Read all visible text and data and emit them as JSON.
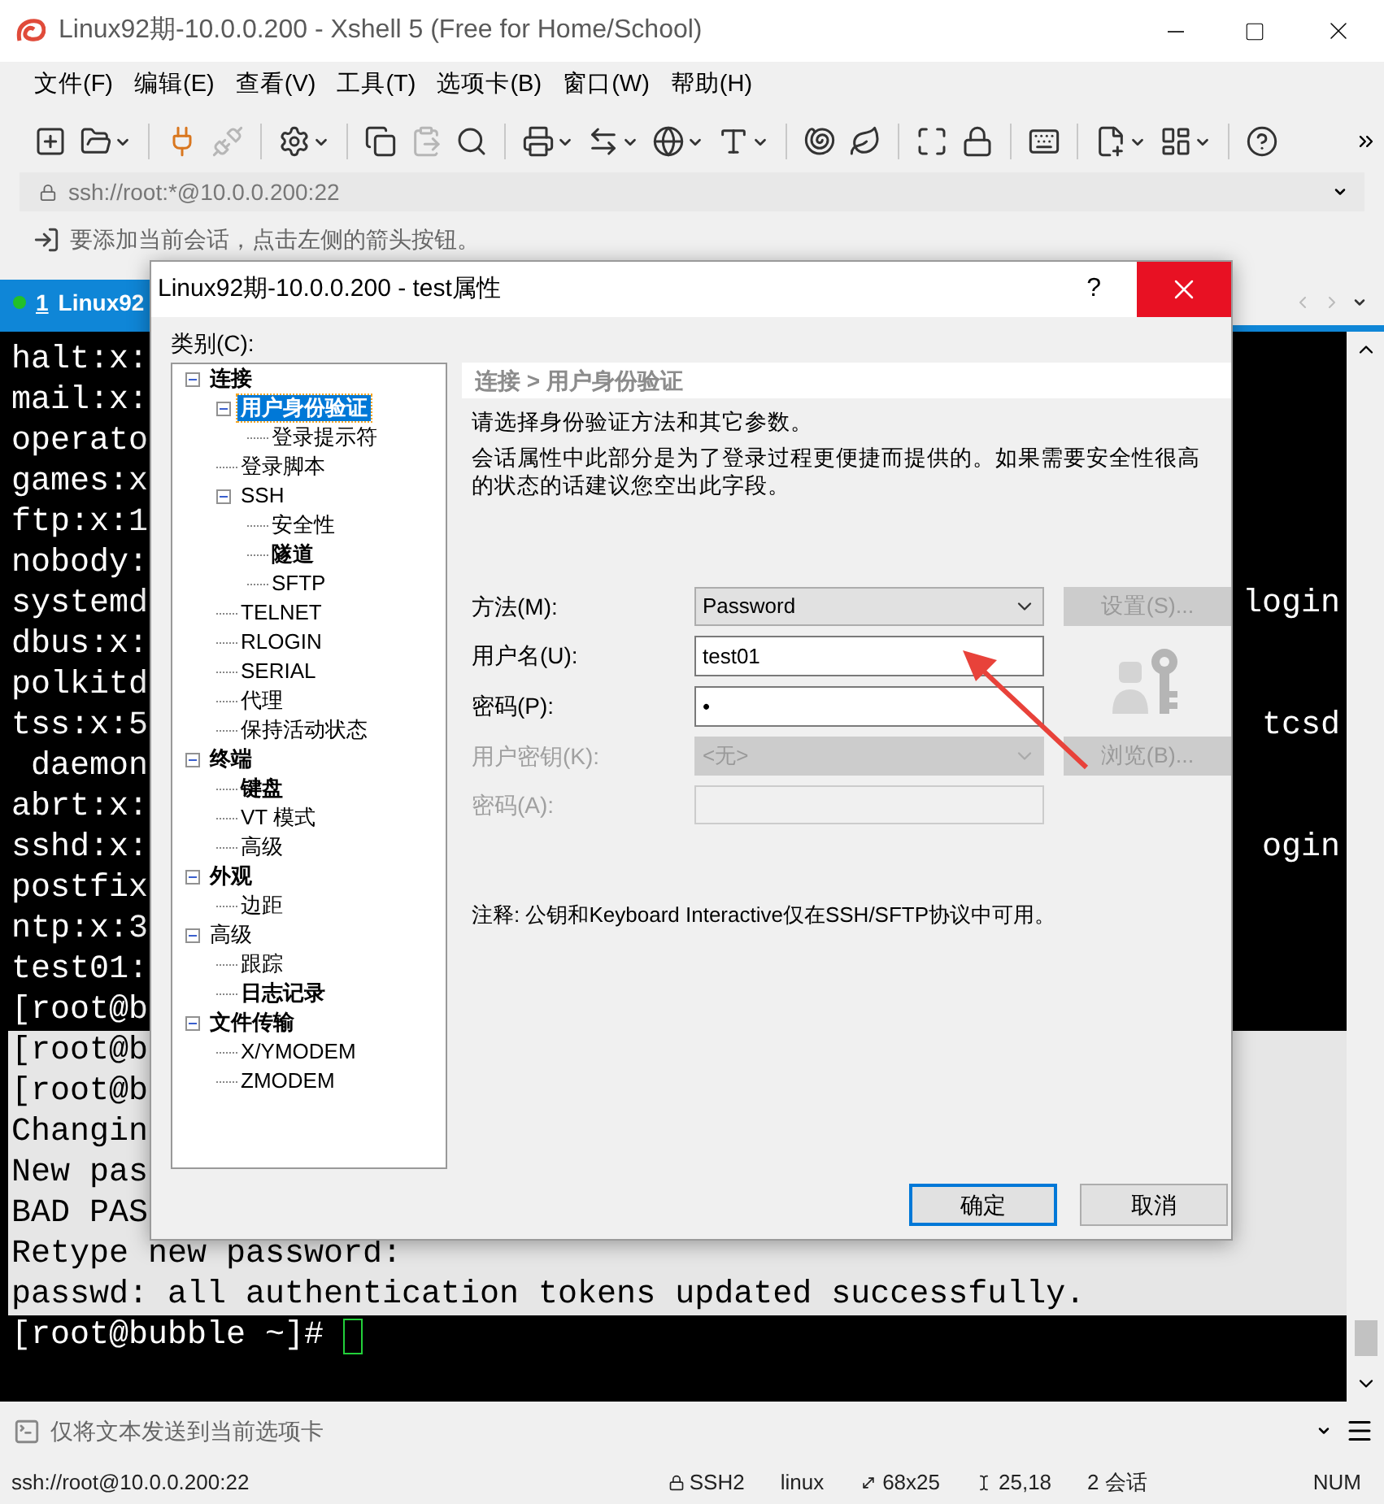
{
  "window": {
    "title": "Linux92期-10.0.0.200 - Xshell 5 (Free for Home/School)"
  },
  "menu": [
    "文件(F)",
    "编辑(E)",
    "查看(V)",
    "工具(T)",
    "选项卡(B)",
    "窗口(W)",
    "帮助(H)"
  ],
  "toolbar": [
    {
      "disabled": false,
      "dropdown": false
    },
    {
      "disabled": false,
      "dropdown": true
    },
    {
      "disabled": false,
      "dropdown": false
    },
    {
      "disabled": true,
      "dropdown": false
    },
    {
      "disabled": false,
      "dropdown": true
    },
    {
      "disabled": false,
      "dropdown": false
    },
    {
      "disabled": true,
      "dropdown": false
    },
    {
      "disabled": false,
      "dropdown": false
    },
    {
      "disabled": false,
      "dropdown": true
    },
    {
      "disabled": false,
      "dropdown": true
    },
    {
      "disabled": false,
      "dropdown": true
    },
    {
      "disabled": false,
      "dropdown": true
    },
    {
      "disabled": false,
      "dropdown": false
    },
    {
      "disabled": false,
      "dropdown": false
    },
    {
      "disabled": false,
      "dropdown": false
    },
    {
      "disabled": false,
      "dropdown": false
    },
    {
      "disabled": false,
      "dropdown": false
    },
    {
      "disabled": false,
      "dropdown": true
    },
    {
      "disabled": false,
      "dropdown": true
    },
    {
      "disabled": false,
      "dropdown": false
    }
  ],
  "address": "ssh://root:*@10.0.0.200:22",
  "hint": "要添加当前会话，点击左侧的箭头按钮。",
  "tabs": [
    {
      "number": "1",
      "label": "Linux92",
      "selected": true,
      "connected": true
    }
  ],
  "terminal": {
    "lines": [
      {
        "text": "halt:x:",
        "highlighted": false,
        "cursor": false
      },
      {
        "text": "mail:x:",
        "highlighted": false,
        "cursor": false
      },
      {
        "text": "operato",
        "highlighted": false,
        "cursor": false
      },
      {
        "text": "games:x",
        "highlighted": false,
        "cursor": false
      },
      {
        "text": "ftp:x:1",
        "highlighted": false,
        "cursor": false
      },
      {
        "text": "nobody:",
        "highlighted": false,
        "cursor": false
      },
      {
        "text": "systemd",
        "tail": "login",
        "highlighted": false,
        "cursor": false
      },
      {
        "text": "dbus:x:",
        "highlighted": false,
        "cursor": false
      },
      {
        "text": "polkitd",
        "highlighted": false,
        "cursor": false
      },
      {
        "text": "tss:x:5",
        "tail": "tcsd",
        "highlighted": false,
        "cursor": false
      },
      {
        "text": " daemon",
        "highlighted": false,
        "cursor": false
      },
      {
        "text": "abrt:x:",
        "highlighted": false,
        "cursor": false
      },
      {
        "text": "sshd:x:",
        "tail": "ogin",
        "highlighted": false,
        "cursor": false
      },
      {
        "text": "postfix",
        "highlighted": false,
        "cursor": false
      },
      {
        "text": "ntp:x:3",
        "highlighted": false,
        "cursor": false
      },
      {
        "text": "test01:",
        "highlighted": false,
        "cursor": false
      },
      {
        "text": "[root@b",
        "highlighted": false,
        "cursor": false
      },
      {
        "text": "[root@b",
        "highlighted": true,
        "cursor": false
      },
      {
        "text": "[root@b",
        "highlighted": true,
        "cursor": false
      },
      {
        "text": "Changin",
        "highlighted": true,
        "cursor": false
      },
      {
        "text": "New pas",
        "highlighted": true,
        "cursor": false
      },
      {
        "text": "BAD PAS",
        "highlighted": true,
        "cursor": false
      },
      {
        "text": "Retype new password:",
        "highlighted": true,
        "cursor": false
      },
      {
        "text": "passwd: all authentication tokens updated successfully.",
        "highlighted": true,
        "cursor": false
      },
      {
        "text": "[root@bubble ~]# ",
        "highlighted": false,
        "cursor": true
      }
    ]
  },
  "compose": {
    "placeholder": "仅将文本发送到当前选项卡"
  },
  "status_bar": {
    "address": "ssh://root@10.0.0.200:22",
    "protocol": "SSH2",
    "terminal_type": "linux",
    "size": "68x25",
    "cursor": "25,18",
    "sessions": "2 会话",
    "num": "NUM"
  },
  "dialog": {
    "title": "Linux92期-10.0.0.200 - test属性",
    "help": "?",
    "category_label": "类别(C):",
    "tree": [
      {
        "label": "连接",
        "modified": true,
        "selected": false,
        "expanded": true,
        "children": [
          {
            "label": "用户身份验证",
            "modified": true,
            "selected": true,
            "expanded": true,
            "children": [
              {
                "label": "登录提示符",
                "modified": false,
                "selected": false
              }
            ]
          },
          {
            "label": "登录脚本",
            "modified": false,
            "selected": false
          },
          {
            "label": "SSH",
            "modified": false,
            "selected": false,
            "expanded": true,
            "children": [
              {
                "label": "安全性",
                "modified": false,
                "selected": false
              },
              {
                "label": "隧道",
                "modified": true,
                "selected": false
              },
              {
                "label": "SFTP",
                "modified": false,
                "selected": false
              }
            ]
          },
          {
            "label": "TELNET",
            "modified": false,
            "selected": false
          },
          {
            "label": "RLOGIN",
            "modified": false,
            "selected": false
          },
          {
            "label": "SERIAL",
            "modified": false,
            "selected": false
          },
          {
            "label": "代理",
            "modified": false,
            "selected": false
          },
          {
            "label": "保持活动状态",
            "modified": false,
            "selected": false
          }
        ]
      },
      {
        "label": "终端",
        "modified": true,
        "selected": false,
        "expanded": true,
        "children": [
          {
            "label": "键盘",
            "modified": true,
            "selected": false
          },
          {
            "label": "VT 模式",
            "modified": false,
            "selected": false
          },
          {
            "label": "高级",
            "modified": false,
            "selected": false
          }
        ]
      },
      {
        "label": "外观",
        "modified": true,
        "selected": false,
        "expanded": true,
        "children": [
          {
            "label": "边距",
            "modified": false,
            "selected": false
          }
        ]
      },
      {
        "label": "高级",
        "modified": false,
        "selected": false,
        "expanded": true,
        "children": [
          {
            "label": "跟踪",
            "modified": false,
            "selected": false
          },
          {
            "label": "日志记录",
            "modified": true,
            "selected": false
          }
        ]
      },
      {
        "label": "文件传输",
        "modified": true,
        "selected": false,
        "expanded": true,
        "children": [
          {
            "label": "X/YMODEM",
            "modified": false,
            "selected": false
          },
          {
            "label": "ZMODEM",
            "modified": false,
            "selected": false
          }
        ]
      }
    ],
    "breadcrumb": "连接 > 用户身份验证",
    "description": [
      "请选择身份验证方法和其它参数。",
      "会话属性中此部分是为了登录过程更便捷而提供的。如果需要安全性很高的状态的话建议您空出此字段。"
    ],
    "form": [
      {
        "kind": "select",
        "label": "方法(M):",
        "value": "Password",
        "disabled": false
      },
      {
        "kind": "input",
        "label": "用户名(U):",
        "value": "test01",
        "disabled": false
      },
      {
        "kind": "input",
        "label": "密码(P):",
        "value": "•",
        "disabled": false
      },
      {
        "kind": "select",
        "label": "用户密钥(K):",
        "value": "<无>",
        "disabled": true
      },
      {
        "kind": "input",
        "label": "密码(A):",
        "disabled": true
      }
    ],
    "side_buttons": [
      {
        "label": "设置(S)...",
        "disabled": true
      },
      {
        "label": "浏览(B)...",
        "disabled": true
      }
    ],
    "note": "注释: 公钥和Keyboard Interactive仅在SSH/SFTP协议中可用。",
    "buttons": [
      {
        "label": "确定",
        "default": true
      },
      {
        "label": "取消",
        "default": false
      }
    ]
  }
}
